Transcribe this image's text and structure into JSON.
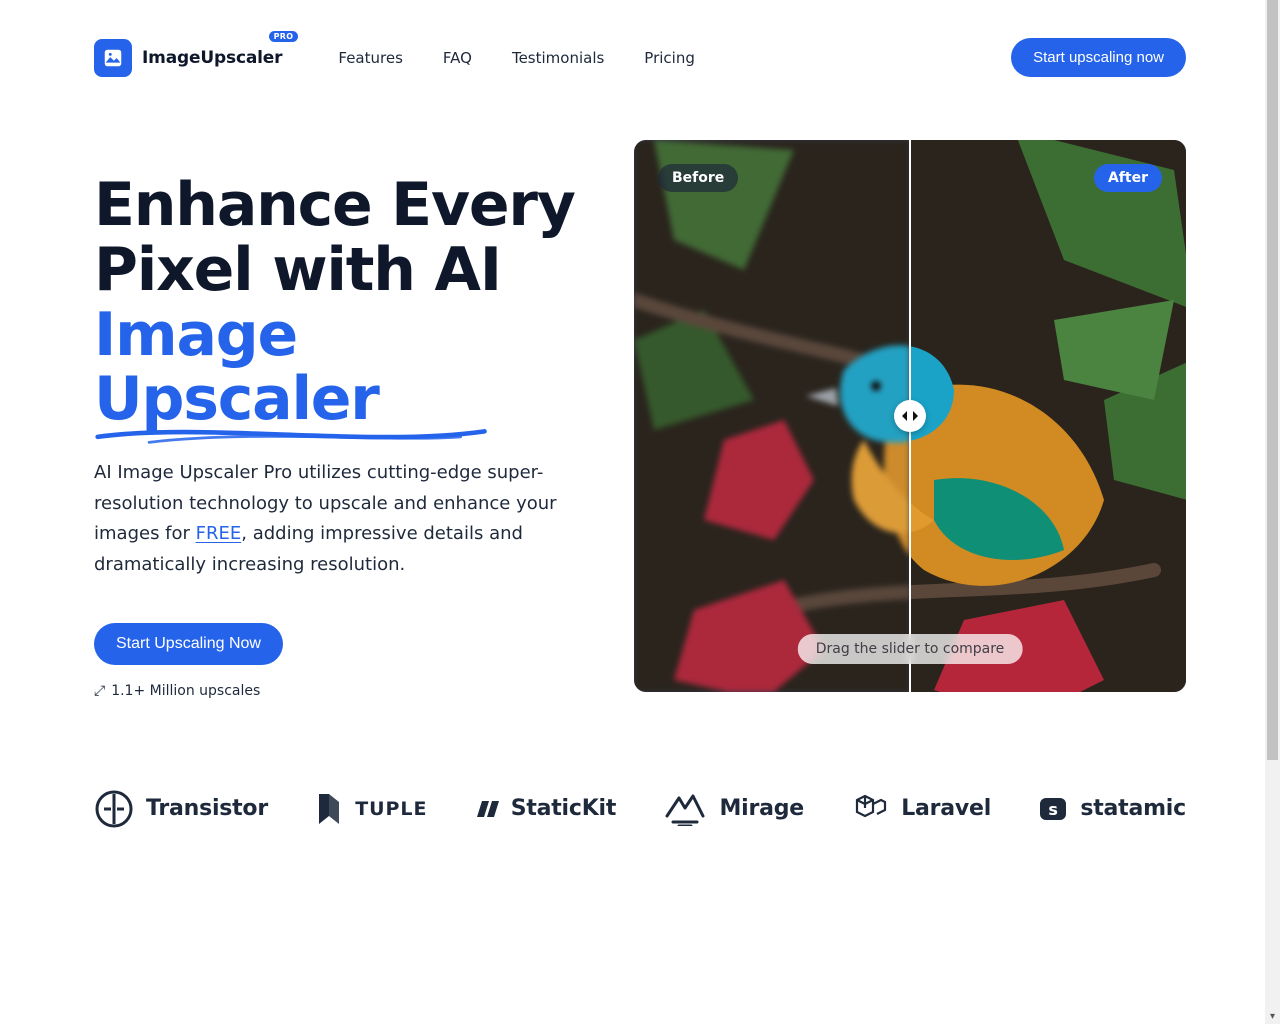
{
  "brand": {
    "name": "ImageUpscaler",
    "pro": "PRO"
  },
  "nav": {
    "features": "Features",
    "faq": "FAQ",
    "testimonials": "Testimonials",
    "pricing": "Pricing"
  },
  "cta_top": "Start upscaling now",
  "hero": {
    "line1": "Enhance Every Pixel with AI",
    "line2_accent": "Image Upscaler",
    "sub_a": "AI Image Upscaler Pro utilizes cutting-edge super-resolution technology to upscale and enhance your images for ",
    "sub_free": "FREE",
    "sub_b": ", adding impressive details and dramatically increasing resolution.",
    "cta": "Start Upscaling Now",
    "stat": "1.1+ Million upscales"
  },
  "compare": {
    "before": "Before",
    "after": "After",
    "hint": "Drag the slider to compare"
  },
  "logos": {
    "transistor": "Transistor",
    "tuple": "TUPLE",
    "statickit": "StaticKit",
    "mirage": "Mirage",
    "laravel": "Laravel",
    "statamic": "statamic"
  }
}
